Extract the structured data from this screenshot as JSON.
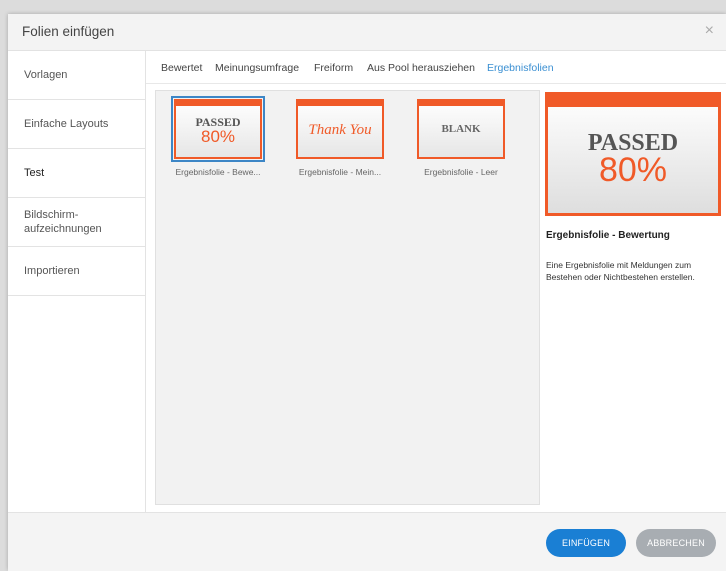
{
  "dialog": {
    "title": "Folien einfügen",
    "close_icon": "×"
  },
  "sidebar": {
    "items": [
      {
        "label": "Vorlagen"
      },
      {
        "label": "Einfache Layouts"
      },
      {
        "label": "Test",
        "active": true
      },
      {
        "label": "Bildschirm-\naufzeichnungen"
      },
      {
        "label": "Importieren"
      }
    ]
  },
  "tabs": [
    {
      "label": "Bewertet"
    },
    {
      "label": "Meinungsumfrage"
    },
    {
      "label": "Freiform"
    },
    {
      "label": "Aus Pool herausziehen"
    },
    {
      "label": "Ergebnisfolien",
      "active": true
    }
  ],
  "thumbnails": [
    {
      "art_line1": "PASSED",
      "art_line2": "80%",
      "caption": "Ergebnisfolie - Bewe...",
      "selected": true
    },
    {
      "art_line1": "Thank You",
      "caption": "Ergebnisfolie - Mein..."
    },
    {
      "art_line1": "BLANK",
      "caption": "Ergebnisfolie - Leer"
    }
  ],
  "preview": {
    "art_line1": "PASSED",
    "art_line2": "80%",
    "title": "Ergebnisfolie - Bewertung",
    "description": "Eine Ergebnisfolie mit Meldungen zum Bestehen oder Nichtbestehen erstellen."
  },
  "footer": {
    "insert_label": "EINFÜGEN",
    "cancel_label": "ABBRECHEN"
  },
  "colors": {
    "accent": "#f05a28",
    "link": "#3a8fd2",
    "primary_button": "#1a7fd4",
    "secondary_button": "#a8adb2"
  }
}
